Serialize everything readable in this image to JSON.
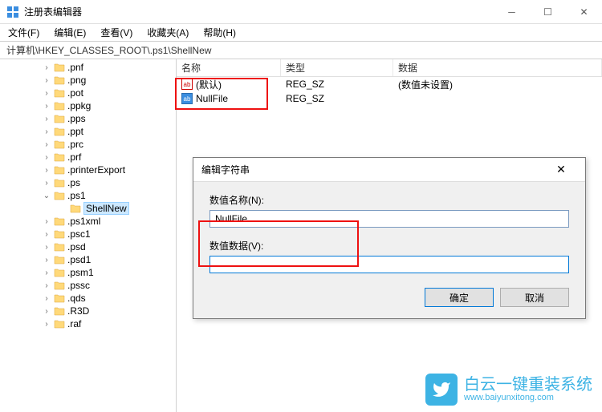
{
  "window": {
    "title": "注册表编辑器"
  },
  "menu": {
    "file": "文件(F)",
    "edit": "编辑(E)",
    "view": "查看(V)",
    "favorites": "收藏夹(A)",
    "help": "帮助(H)"
  },
  "path": "计算机\\HKEY_CLASSES_ROOT\\.ps1\\ShellNew",
  "tree": [
    {
      "label": ".pnf",
      "indent": 52
    },
    {
      "label": ".png",
      "indent": 52
    },
    {
      "label": ".pot",
      "indent": 52
    },
    {
      "label": ".ppkg",
      "indent": 52
    },
    {
      "label": ".pps",
      "indent": 52
    },
    {
      "label": ".ppt",
      "indent": 52
    },
    {
      "label": ".prc",
      "indent": 52
    },
    {
      "label": ".prf",
      "indent": 52
    },
    {
      "label": ".printerExport",
      "indent": 52
    },
    {
      "label": ".ps",
      "indent": 52
    },
    {
      "label": ".ps1",
      "indent": 52,
      "expanded": true
    },
    {
      "label": "ShellNew",
      "indent": 72,
      "selected": true,
      "noexpand": true
    },
    {
      "label": ".ps1xml",
      "indent": 52
    },
    {
      "label": ".psc1",
      "indent": 52
    },
    {
      "label": ".psd",
      "indent": 52
    },
    {
      "label": ".psd1",
      "indent": 52
    },
    {
      "label": ".psm1",
      "indent": 52
    },
    {
      "label": ".pssc",
      "indent": 52
    },
    {
      "label": ".qds",
      "indent": 52
    },
    {
      "label": ".R3D",
      "indent": 52
    },
    {
      "label": ".raf",
      "indent": 52
    }
  ],
  "list": {
    "cols": {
      "name": "名称",
      "type": "类型",
      "data": "数据"
    },
    "rows": [
      {
        "icon": "str",
        "name": "(默认)",
        "type": "REG_SZ",
        "data": "(数值未设置)"
      },
      {
        "icon": "bin",
        "name": "NullFile",
        "type": "REG_SZ",
        "data": ""
      }
    ]
  },
  "dialog": {
    "title": "编辑字符串",
    "name_label": "数值名称(N):",
    "name_value": "NullFile",
    "data_label": "数值数据(V):",
    "data_value": "",
    "ok": "确定",
    "cancel": "取消"
  },
  "watermark": {
    "text": "白云一键重装系统",
    "sub": "www.baiyunxitong.com"
  }
}
